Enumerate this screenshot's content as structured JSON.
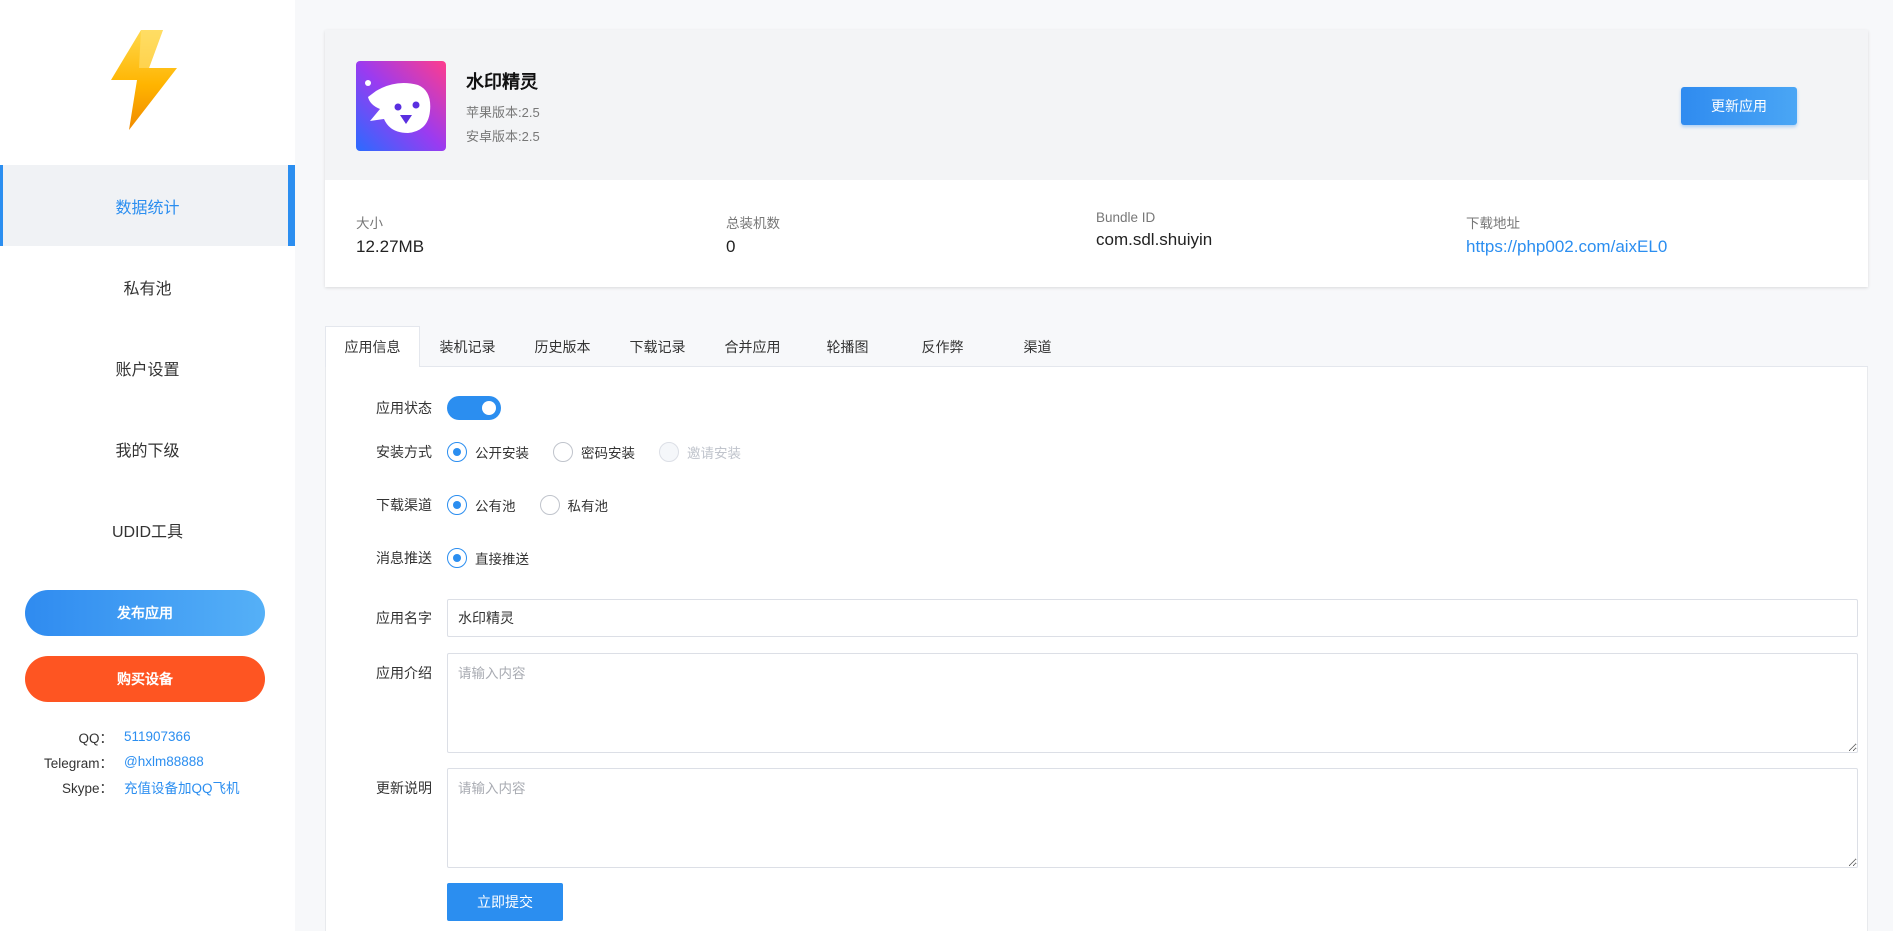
{
  "sidebar": {
    "logo": "lightning-logo",
    "items": [
      {
        "label": "数据统计",
        "active": true
      },
      {
        "label": "私有池",
        "active": false
      },
      {
        "label": "账户设置",
        "active": false
      },
      {
        "label": "我的下级",
        "active": false
      },
      {
        "label": "UDID工具",
        "active": false
      }
    ],
    "publish_label": "发布应用",
    "buy_label": "购买设备",
    "contacts": [
      {
        "label": "QQ：",
        "value": "511907366"
      },
      {
        "label": "Telegram：",
        "value": "@hxlm88888"
      },
      {
        "label": "Skype：",
        "value": "充值设备加QQ飞机"
      }
    ]
  },
  "app": {
    "name": "水印精灵",
    "ios_version": "苹果版本:2.5",
    "android_version": "安卓版本:2.5",
    "update_label": "更新应用",
    "icon": "ghost-face-app-icon"
  },
  "stats": {
    "size_label": "大小",
    "size_value": "12.27MB",
    "installs_label": "总装机数",
    "installs_value": "0",
    "bundle_label": "Bundle ID",
    "bundle_value": "com.sdl.shuiyin",
    "download_label": "下载地址",
    "download_value": "https://php002.com/aixEL0"
  },
  "tabs": [
    {
      "label": "应用信息",
      "active": true
    },
    {
      "label": "装机记录",
      "active": false
    },
    {
      "label": "历史版本",
      "active": false
    },
    {
      "label": "下载记录",
      "active": false
    },
    {
      "label": "合并应用",
      "active": false
    },
    {
      "label": "轮播图",
      "active": false
    },
    {
      "label": "反作弊",
      "active": false
    },
    {
      "label": "渠道",
      "active": false
    }
  ],
  "form": {
    "status_label": "应用状态",
    "status_on": true,
    "install_label": "安装方式",
    "install_options": [
      "公开安装",
      "密码安装",
      "邀请安装"
    ],
    "install_selected": "公开安装",
    "channel_label": "下载渠道",
    "channel_options": [
      "公有池",
      "私有池"
    ],
    "channel_selected": "公有池",
    "push_label": "消息推送",
    "push_options": [
      "直接推送"
    ],
    "name_label": "应用名字",
    "name_value": "水印精灵",
    "intro_label": "应用介绍",
    "intro_placeholder": "请输入内容",
    "update_label": "更新说明",
    "update_placeholder": "请输入内容",
    "submit_label": "立即提交"
  },
  "colors": {
    "accent": "#2b8ef0",
    "buy": "#fe5522",
    "sidebar_active_bg": "#f0f2f5"
  }
}
